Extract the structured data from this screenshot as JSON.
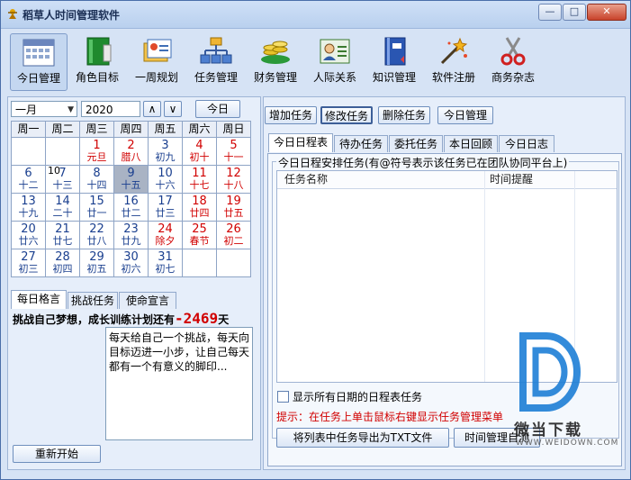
{
  "window": {
    "title": "稻草人时间管理软件",
    "minimize": "—",
    "maximize": "□",
    "close": "✕"
  },
  "toolbar": [
    {
      "label": "今日管理",
      "icon": "calendar-icon"
    },
    {
      "label": "角色目标",
      "icon": "book-icon"
    },
    {
      "label": "一周规划",
      "icon": "cards-icon"
    },
    {
      "label": "任务管理",
      "icon": "tree-icon"
    },
    {
      "label": "财务管理",
      "icon": "coins-icon"
    },
    {
      "label": "人际关系",
      "icon": "contact-card-icon"
    },
    {
      "label": "知识管理",
      "icon": "notebook-icon"
    },
    {
      "label": "软件注册",
      "icon": "magic-wand-icon"
    },
    {
      "label": "商务杂志",
      "icon": "scissors-icon"
    }
  ],
  "calendar": {
    "month": "一月",
    "year": "2020",
    "up": "∧",
    "down": "∨",
    "today_button": "今日",
    "weekdays": [
      "周一",
      "周二",
      "周三",
      "周四",
      "周五",
      "周六",
      "周日"
    ],
    "rows": [
      [
        {
          "d": "",
          "l": ""
        },
        {
          "d": "",
          "l": ""
        },
        {
          "d": "1",
          "l": "元旦",
          "c": "red"
        },
        {
          "d": "2",
          "l": "腊八",
          "c": "red"
        },
        {
          "d": "3",
          "l": "初九",
          "c": "blue"
        },
        {
          "d": "4",
          "l": "初十",
          "c": "red"
        },
        {
          "d": "5",
          "l": "十一",
          "c": "red"
        }
      ],
      [
        {
          "d": "6",
          "l": "十二",
          "c": "blue"
        },
        {
          "d": "7",
          "l": "十三",
          "c": "blue",
          "m": "10"
        },
        {
          "d": "8",
          "l": "十四",
          "c": "blue"
        },
        {
          "d": "9",
          "l": "十五",
          "c": "blue",
          "sel": true
        },
        {
          "d": "10",
          "l": "十六",
          "c": "blue"
        },
        {
          "d": "11",
          "l": "十七",
          "c": "red"
        },
        {
          "d": "12",
          "l": "十八",
          "c": "red"
        }
      ],
      [
        {
          "d": "13",
          "l": "十九",
          "c": "blue"
        },
        {
          "d": "14",
          "l": "二十",
          "c": "blue"
        },
        {
          "d": "15",
          "l": "廿一",
          "c": "blue"
        },
        {
          "d": "16",
          "l": "廿二",
          "c": "blue"
        },
        {
          "d": "17",
          "l": "廿三",
          "c": "blue"
        },
        {
          "d": "18",
          "l": "廿四",
          "c": "red"
        },
        {
          "d": "19",
          "l": "廿五",
          "c": "red"
        }
      ],
      [
        {
          "d": "20",
          "l": "廿六",
          "c": "blue"
        },
        {
          "d": "21",
          "l": "廿七",
          "c": "blue"
        },
        {
          "d": "22",
          "l": "廿八",
          "c": "blue"
        },
        {
          "d": "23",
          "l": "廿九",
          "c": "blue"
        },
        {
          "d": "24",
          "l": "除夕",
          "c": "red"
        },
        {
          "d": "25",
          "l": "春节",
          "c": "red"
        },
        {
          "d": "26",
          "l": "初二",
          "c": "red"
        }
      ],
      [
        {
          "d": "27",
          "l": "初三",
          "c": "blue"
        },
        {
          "d": "28",
          "l": "初四",
          "c": "blue"
        },
        {
          "d": "29",
          "l": "初五",
          "c": "blue"
        },
        {
          "d": "30",
          "l": "初六",
          "c": "blue"
        },
        {
          "d": "31",
          "l": "初七",
          "c": "blue"
        },
        {
          "d": "",
          "l": ""
        },
        {
          "d": "",
          "l": ""
        }
      ]
    ]
  },
  "left_tabs": [
    "每日格言",
    "挑战任务",
    "使命宣言"
  ],
  "challenge": {
    "prefix": "挑战自己梦想，成长训练计划还有",
    "days": "-2469",
    "suffix": "天"
  },
  "motto_text": "每天给自己一个挑战，每天向目标迈进一小步，让自己每天都有一个有意义的脚印...",
  "restart_button": "重新开始",
  "actions": [
    "增加任务",
    "修改任务",
    "删除任务",
    "今日管理"
  ],
  "right_tabs": [
    "今日日程表",
    "待办任务",
    "委托任务",
    "本日回顾",
    "今日日志"
  ],
  "schedule": {
    "group_title": "今日日程安排任务(有@符号表示该任务已在团队协同平台上)",
    "columns": [
      "任务名称",
      "时间提醒"
    ],
    "show_all_checkbox": "显示所有日期的日程表任务",
    "hint": "提示：在任务上单击鼠标右键显示任务管理菜单",
    "export_button": "将列表中任务导出为TXT文件",
    "help_button": "时间管理自测"
  },
  "watermark": {
    "brand": "微当下载",
    "url": "WWW.WEIDOWN.COM"
  },
  "colors": {
    "accent_red": "#d10000",
    "lunar_blue": "#1a3f8f"
  }
}
